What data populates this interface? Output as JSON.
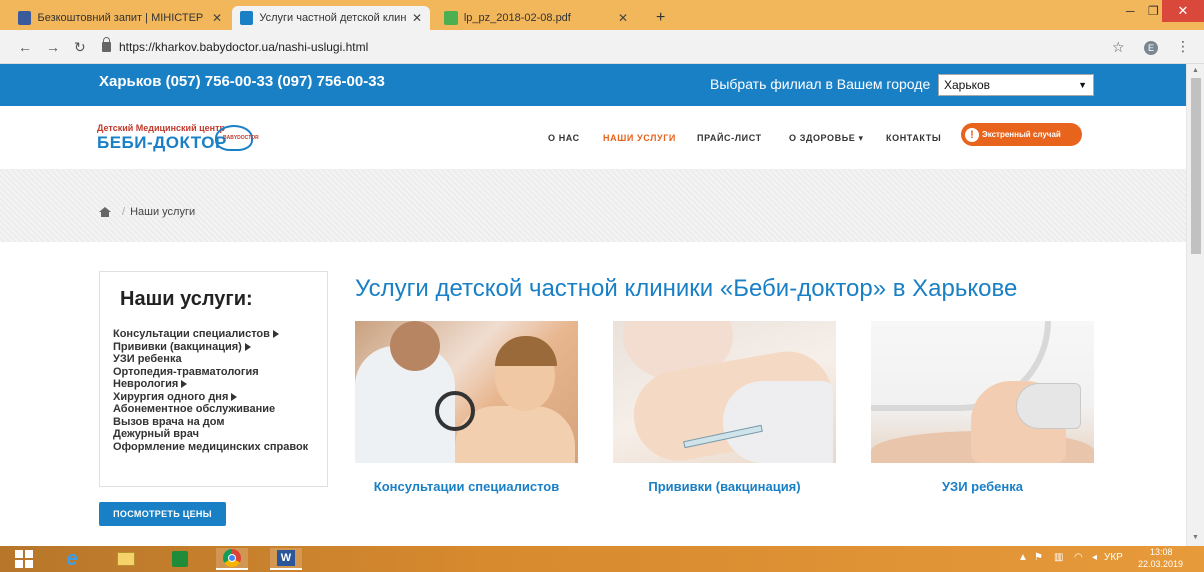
{
  "browser": {
    "tabs": [
      {
        "title": "Безкоштовний запит | МІНІСТЕР",
        "active": false
      },
      {
        "title": "Услуги частной детской клиник",
        "active": true
      },
      {
        "title": "lp_pz_2018-02-08.pdf",
        "active": false
      }
    ],
    "url": "https://kharkov.babydoctor.ua/nashi-uslugi.html",
    "profile_initial": "E"
  },
  "site": {
    "topbar": {
      "phones": "Харьков (057) 756-00-33 (097) 756-00-33",
      "branch_label": "Выбрать филиал в Вашем городе",
      "branch_value": "Харьков"
    },
    "logo": {
      "small": "Детский Медицинский центр",
      "big": "БЕБИ-ДОКТОР",
      "mark": "BABYDOCTOR"
    },
    "nav": {
      "items": [
        "О НАС",
        "НАШИ УСЛУГИ",
        "ПРАЙС-ЛИСТ",
        "О ЗДОРОВЬЕ",
        "КОНТАКТЫ"
      ],
      "active_index": 1,
      "emergency": "Экстренный случай"
    },
    "breadcrumb": {
      "current": "Наши услуги"
    },
    "sidebar": {
      "title": "Наши услуги:",
      "items": [
        {
          "label": "Консультации специалистов",
          "submenu": true
        },
        {
          "label": "Прививки (вакцинация)",
          "submenu": true
        },
        {
          "label": "УЗИ ребенка",
          "submenu": false
        },
        {
          "label": "Ортопедия-травматология",
          "submenu": false
        },
        {
          "label": "Неврология",
          "submenu": true
        },
        {
          "label": "Хирургия одного дня",
          "submenu": true
        },
        {
          "label": "Абонементное обслуживание",
          "submenu": false
        },
        {
          "label": "Вызов врача на дом",
          "submenu": false
        },
        {
          "label": "Дежурный врач",
          "submenu": false
        },
        {
          "label": "Оформление медицинских справок",
          "submenu": false
        }
      ],
      "prices_button": "ПОСМОТРЕТЬ ЦЕНЫ"
    },
    "main": {
      "title": "Услуги детской частной клиники «Беби-доктор» в Харькове",
      "cards": [
        {
          "label": "Консультации специалистов"
        },
        {
          "label": "Прививки (вакцинация)"
        },
        {
          "label": "УЗИ ребенка"
        }
      ]
    }
  },
  "taskbar": {
    "language": "УКР",
    "time": "13:08",
    "date": "22.03.2019"
  },
  "colors": {
    "brand_blue": "#1a80c6",
    "accent_orange": "#e8631c",
    "tab_bar": "#f2b75a"
  }
}
